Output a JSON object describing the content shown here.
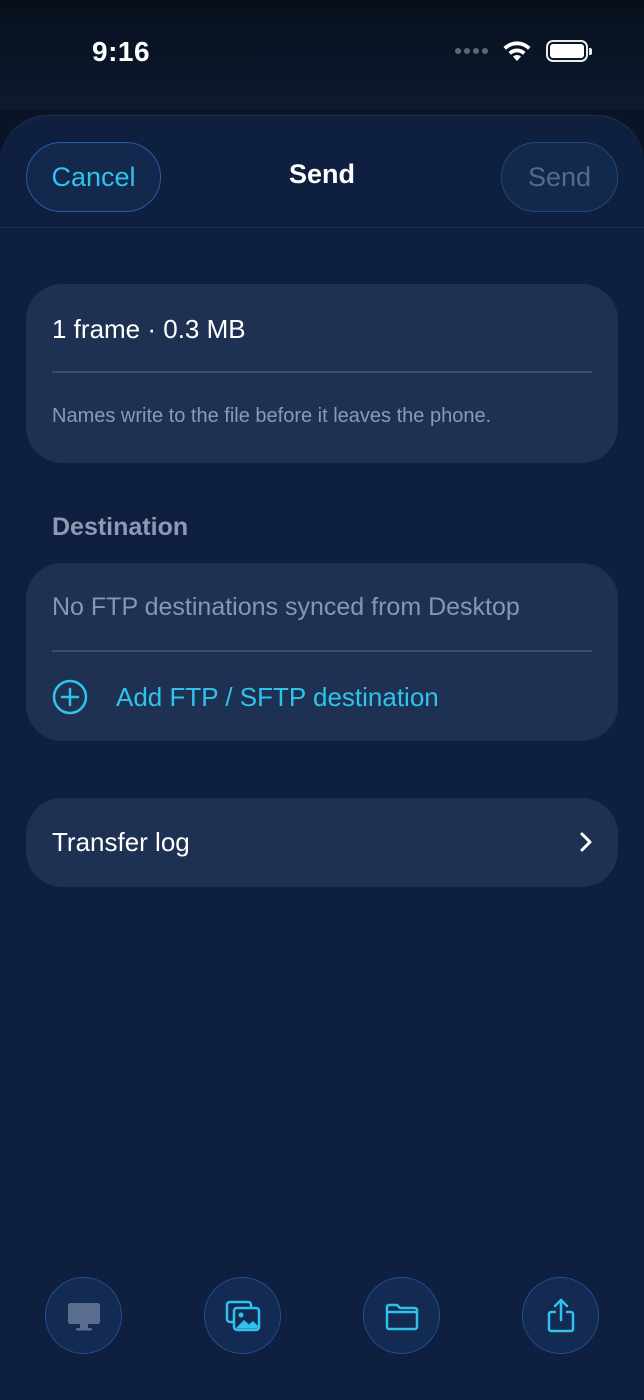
{
  "status_bar": {
    "time": "9:16"
  },
  "nav": {
    "cancel_label": "Cancel",
    "title": "Send",
    "send_label": "Send"
  },
  "summary": {
    "frame_info": "1 frame · 0.3 MB",
    "note": "Names write to the file before it leaves the phone."
  },
  "destination": {
    "section_label": "Destination",
    "empty_message": "No FTP destinations synced from Desktop",
    "add_label": "Add FTP / SFTP destination"
  },
  "transfer_log": {
    "label": "Transfer log"
  },
  "bottom_bar": {
    "items": [
      {
        "icon": "desktop-icon",
        "enabled": false
      },
      {
        "icon": "photos-icon",
        "enabled": true
      },
      {
        "icon": "folder-icon",
        "enabled": true
      },
      {
        "icon": "share-icon",
        "enabled": true
      }
    ]
  },
  "colors": {
    "accent": "#2fc3ec",
    "sheet_background": "#0f1f40",
    "card_background": "#1f3152",
    "disabled": "#566986"
  }
}
